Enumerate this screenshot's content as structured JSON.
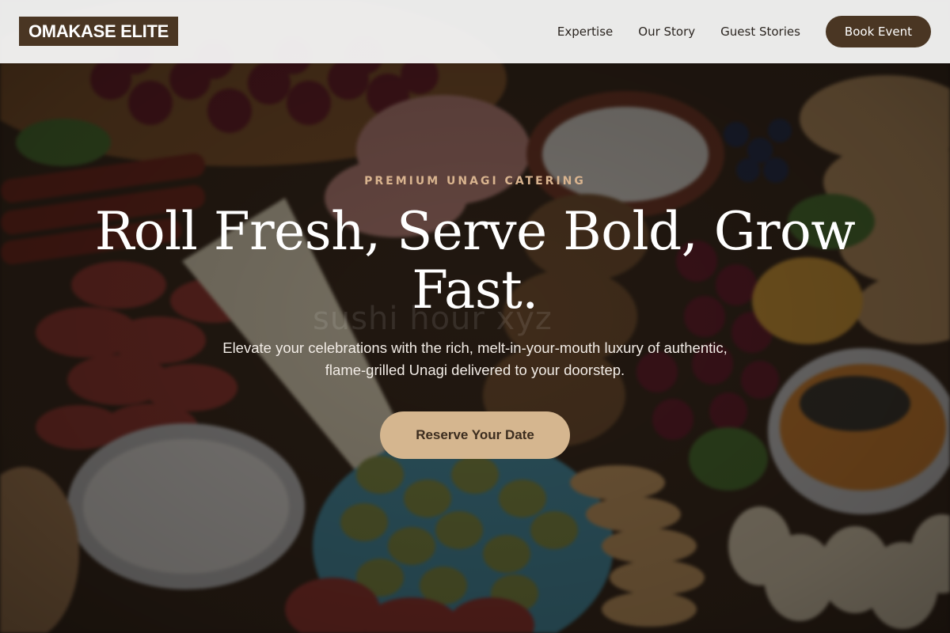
{
  "header": {
    "logo": "OMAKASE ELITE",
    "nav": [
      "Expertise",
      "Our Story",
      "Guest Stories"
    ],
    "cta_label": "Book Event"
  },
  "hero": {
    "eyebrow": "PREMIUM UNAGI CATERING",
    "headline": "Roll Fresh, Serve Bold, Grow Fast.",
    "watermark": "sushi hour xyz",
    "subhead": "Elevate your celebrations with the rich, melt-in-your-mouth luxury of authentic, flame-grilled Unagi delivered to your doorstep.",
    "cta_label": "Reserve Your Date",
    "background_image": "charcuterie-platter-photo"
  },
  "colors": {
    "brand_dark": "#4a3623",
    "accent": "#d5b68f",
    "eyebrow": "#d9b48f",
    "header_bg": "#f8f8f8",
    "text_light": "#ffffff"
  }
}
